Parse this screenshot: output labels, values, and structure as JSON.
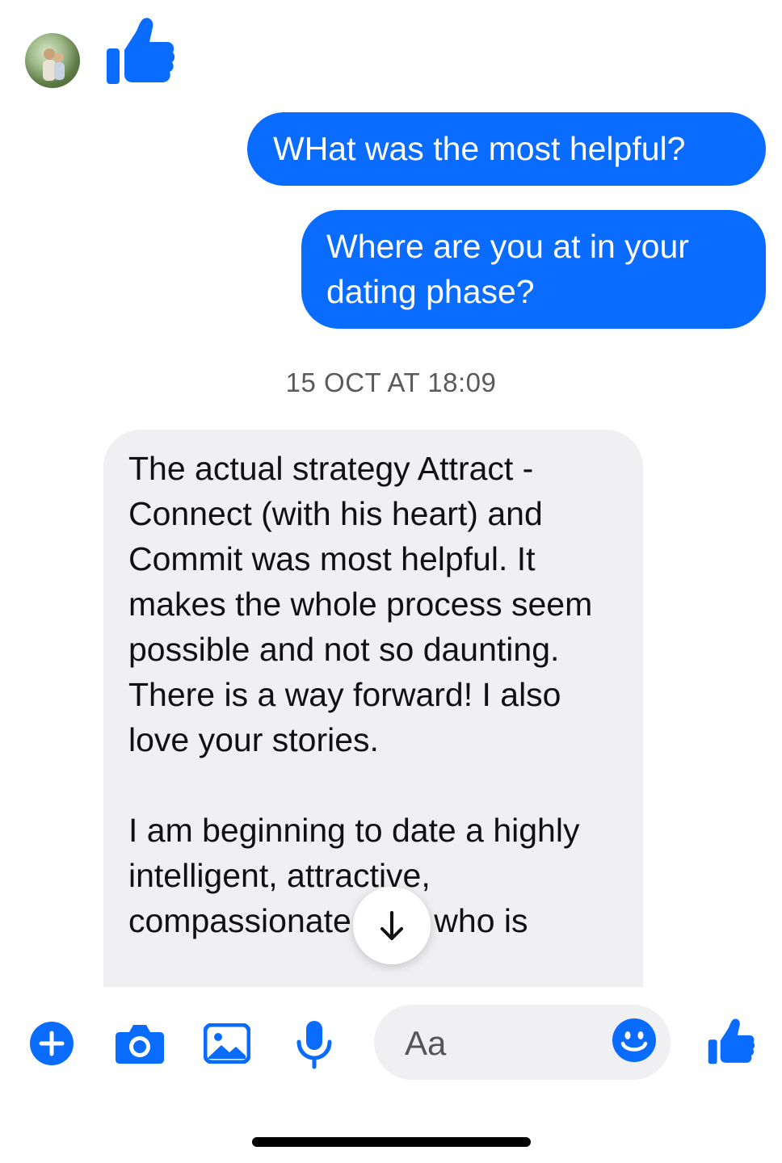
{
  "colors": {
    "accent": "#0a6cff",
    "outgoing_bubble": "#0a6cff",
    "incoming_bubble": "#f0f0f3"
  },
  "header_row": {
    "avatar_icon": "contact-avatar",
    "reaction_icon": "thumbs-up-icon"
  },
  "messages_outgoing": [
    {
      "text": "WHat was the most helpful?"
    },
    {
      "text": "Where are you at in your dating phase?"
    }
  ],
  "timestamp": "15 OCT AT 18:09",
  "message_incoming": {
    "paragraphs": [
      "The actual strategy Attract - Connect (with his heart) and Commit was most helpful. It makes the whole process seem possible and not so daunting. There is a way forward! I also love your stories.",
      "I am beginning to date a highly intelligent, attractive, compassionate man who is"
    ]
  },
  "scroll_button": {
    "icon": "arrow-down-icon"
  },
  "composer": {
    "placeholder": "Aa",
    "icons": [
      "plus-icon",
      "camera-icon",
      "image-icon",
      "microphone-icon",
      "emoji-icon",
      "thumbs-up-icon"
    ]
  }
}
